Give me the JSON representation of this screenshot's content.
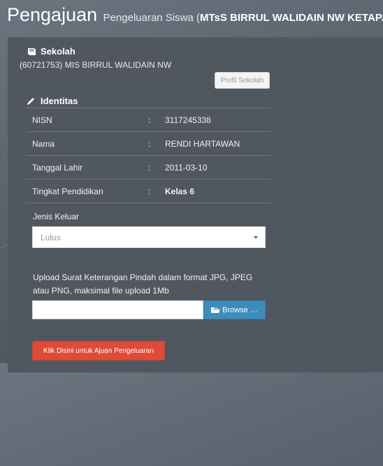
{
  "header": {
    "title": "Pengajuan",
    "subtitle_prefix": "Pengeluaran Siswa (",
    "subtitle_school": "MTsS BIRRUL WALIDAIN NW KETAPAK",
    "subtitle_suffix": ")"
  },
  "sekolah": {
    "heading": "Sekolah",
    "icon": "book-icon",
    "info": "(60721753) MIS BIRRUL WALIDAIN NW",
    "profil_button": "Profil Sekolah"
  },
  "identitas": {
    "heading": "Identitas",
    "icon": "pencil-icon",
    "rows": [
      {
        "label": "NISN",
        "colon": ":",
        "value": "3117245338"
      },
      {
        "label": "Nama",
        "colon": ":",
        "value": "RENDI HARTAWAN"
      },
      {
        "label": "Tanggal Lahir",
        "colon": ":",
        "value": "2011-03-10"
      },
      {
        "label": "Tingkat Pendidikan",
        "colon": ":",
        "value": "Kelas 6"
      }
    ]
  },
  "jenis_keluar": {
    "label": "Jenis Keluar",
    "selected": "Lulus"
  },
  "upload": {
    "instruction": "Upload Surat Keterangan Pindah dalam format JPG, JPEG atau PNG, maksimal file upload 1Mb",
    "browse_label": "Browse …",
    "browse_icon": "folder-open-icon"
  },
  "submit_label": "Klik Disini untuk Ajuan Pengeluaran",
  "colors": {
    "panel": "#50575f",
    "browse": "#3c8dbc",
    "submit": "#dd4b39"
  }
}
